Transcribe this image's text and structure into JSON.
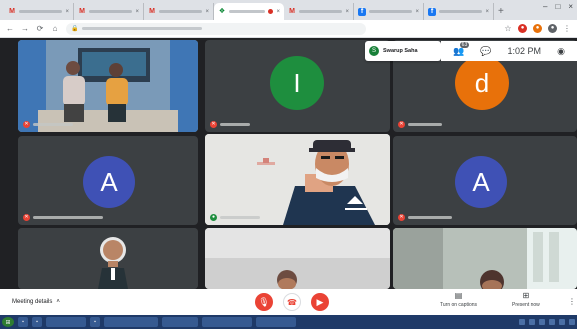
{
  "browser": {
    "tabs": [
      {
        "favicon": "gmail-icon",
        "glyph": "M",
        "title": "",
        "active": false
      },
      {
        "favicon": "gmail-icon",
        "glyph": "M",
        "title": "",
        "active": false
      },
      {
        "favicon": "gmail-icon",
        "glyph": "M",
        "title": "",
        "active": false
      },
      {
        "favicon": "meet-icon",
        "glyph": "❖",
        "title": "",
        "active": true,
        "recording": true
      },
      {
        "favicon": "gmail-icon",
        "glyph": "M",
        "title": "",
        "active": false
      },
      {
        "favicon": "facebook-icon",
        "glyph": "f",
        "title": "",
        "active": false
      },
      {
        "favicon": "facebook-icon",
        "glyph": "f",
        "title": "",
        "active": false
      }
    ],
    "new_tab": "+",
    "address": "",
    "window_controls": {
      "minimize": "–",
      "maximize": "□",
      "close": "×"
    }
  },
  "meet": {
    "self_chip": {
      "initial": "S",
      "name": "Swarup Saha",
      "subtitle": ""
    },
    "top_bar": {
      "participants_count": "63",
      "time": "1:02 PM"
    },
    "tiles": [
      {
        "type": "video",
        "scene": "two-people-stage",
        "muted": true,
        "name": ""
      },
      {
        "type": "avatar",
        "initial": "I",
        "color": "#1e8e3e",
        "muted": true,
        "name": ""
      },
      {
        "type": "avatar",
        "initial": "d",
        "color": "#e8710a",
        "muted": true,
        "name": ""
      },
      {
        "type": "avatar",
        "initial": "A",
        "color": "#3f51b5",
        "muted": true,
        "name": ""
      },
      {
        "type": "video",
        "scene": "speaker-closeup",
        "muted": false,
        "name": ""
      },
      {
        "type": "avatar",
        "initial": "A",
        "color": "#3f51b5",
        "muted": true,
        "name": ""
      },
      {
        "type": "video",
        "scene": "person-small",
        "muted": false,
        "name": ""
      },
      {
        "type": "video",
        "scene": "room-ceiling",
        "muted": false,
        "name": ""
      },
      {
        "type": "video",
        "scene": "room-window",
        "muted": false,
        "name": ""
      }
    ]
  },
  "controls": {
    "meeting_details": "Meeting details",
    "meeting_details_chevron": "˄",
    "captions_label": "Turn on captions",
    "present_label": "Present now"
  },
  "colors": {
    "meet_bg": "#202124",
    "danger": "#ea4335",
    "taskbar": "#1f3a68"
  }
}
